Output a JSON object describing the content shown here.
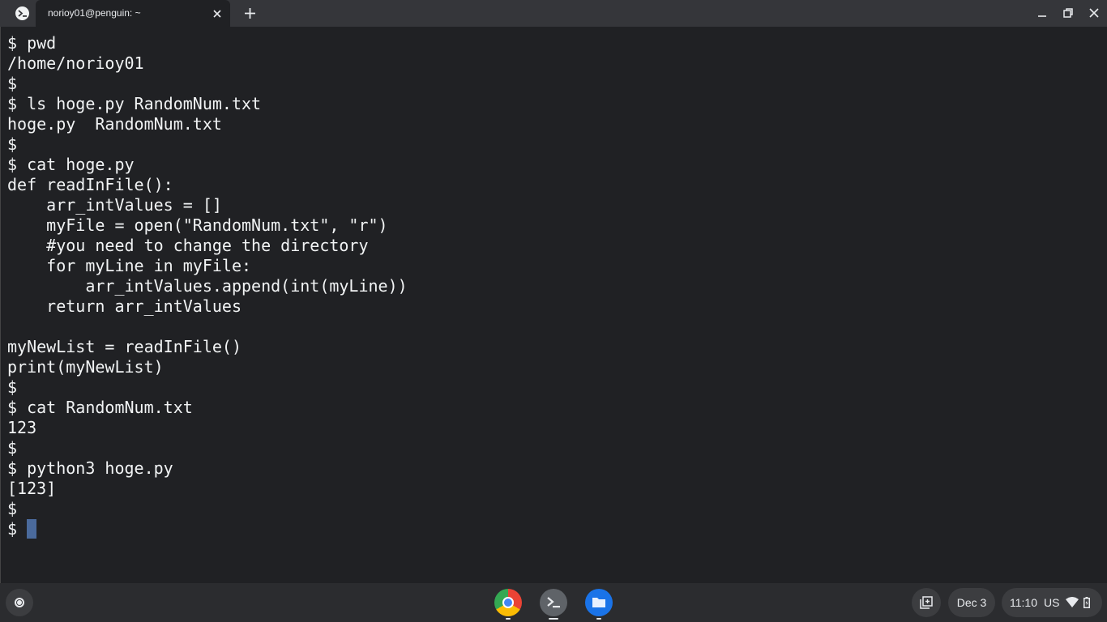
{
  "window": {
    "tab_title": "norioy01@penguin: ~"
  },
  "terminal": {
    "lines": [
      "$ pwd",
      "/home/norioy01",
      "$",
      "$ ls hoge.py RandomNum.txt",
      "hoge.py  RandomNum.txt",
      "$",
      "$ cat hoge.py",
      "def readInFile():",
      "    arr_intValues = []",
      "    myFile = open(\"RandomNum.txt\", \"r\")",
      "    #you need to change the directory",
      "    for myLine in myFile:",
      "        arr_intValues.append(int(myLine))",
      "    return arr_intValues",
      "",
      "myNewList = readInFile()",
      "print(myNewList)",
      "$",
      "$ cat RandomNum.txt",
      "123",
      "$",
      "$ python3 hoge.py",
      "[123]",
      "$",
      "$ "
    ]
  },
  "shelf": {
    "apps": [
      "chrome-icon",
      "terminal-icon",
      "files-icon"
    ],
    "date": "Dec 3",
    "time": "11:10",
    "ime": "US"
  },
  "colors": {
    "terminal_bg": "#202124",
    "text": "#f1f3f4",
    "cursor": "#4a6a9c",
    "titlebar_bg": "#35363a",
    "shelf_bg": "#2b2c2f"
  }
}
